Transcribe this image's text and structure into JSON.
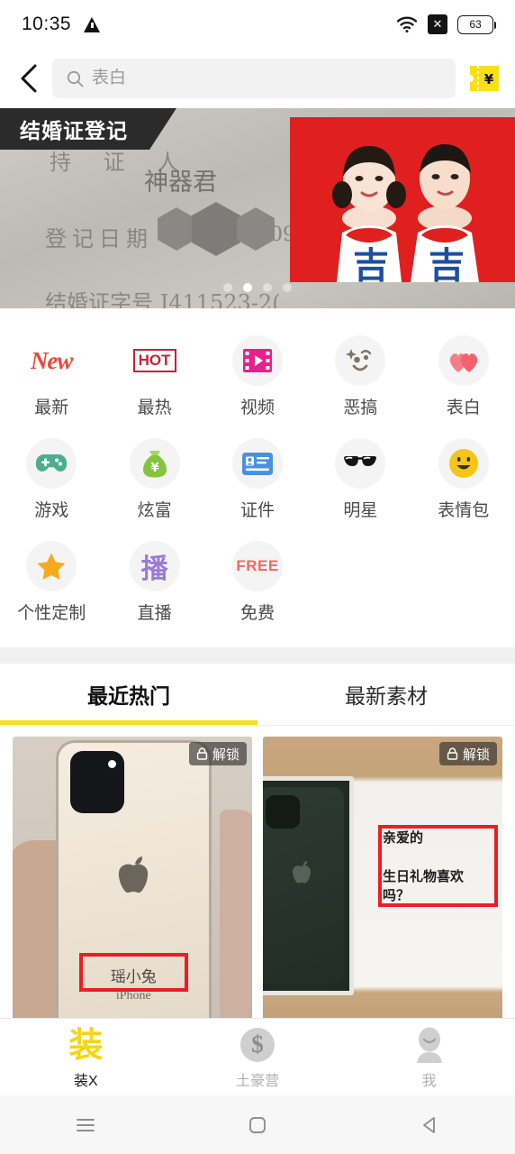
{
  "status_bar": {
    "time": "10:35",
    "warning_icon": "warning-triangle-icon",
    "wifi_icon": "wifi-icon",
    "signal_badge": "✕",
    "battery_level": "63"
  },
  "header": {
    "back_icon": "back-chevron-icon",
    "search": {
      "icon": "search-icon",
      "placeholder": "表白",
      "value": ""
    },
    "coupon": {
      "icon": "coupon-icon",
      "symbol": "¥",
      "color": "#f7e016"
    }
  },
  "banner": {
    "tag_label": "结婚证登记",
    "cert_text": {
      "line1": "持 证 人",
      "line2": "神器君",
      "line3": "登记日期",
      "line4": "结婚证字号 J411523-2(",
      "partial_date": "09"
    },
    "dots_total": 4,
    "dots_active_index": 1
  },
  "icon_grid": {
    "items": [
      {
        "label": "最新",
        "icon": "new-badge-icon",
        "glyph": "New",
        "style": "new",
        "color": "#f0453a"
      },
      {
        "label": "最热",
        "icon": "hot-badge-icon",
        "glyph": "HOT",
        "style": "hot",
        "color": "#c9213a"
      },
      {
        "label": "视频",
        "icon": "video-film-icon",
        "glyph": "",
        "style": "svg",
        "color": "#e6218c"
      },
      {
        "label": "恶搞",
        "icon": "prank-face-icon",
        "glyph": "",
        "style": "svg",
        "color": "#7d7468"
      },
      {
        "label": "表白",
        "icon": "double-heart-icon",
        "glyph": "",
        "style": "svg",
        "color": "#f4606c"
      },
      {
        "label": "游戏",
        "icon": "gamepad-icon",
        "glyph": "",
        "style": "svg",
        "color": "#4cae8f"
      },
      {
        "label": "炫富",
        "icon": "money-bag-icon",
        "glyph": "",
        "style": "svg",
        "color": "#86c440"
      },
      {
        "label": "证件",
        "icon": "id-card-icon",
        "glyph": "",
        "style": "svg",
        "color": "#4a90e2"
      },
      {
        "label": "明星",
        "icon": "sunglasses-icon",
        "glyph": "",
        "style": "svg",
        "color": "#1c1c1c"
      },
      {
        "label": "表情包",
        "icon": "smiley-emoji-icon",
        "glyph": "",
        "style": "svg",
        "color": "#f5c518"
      },
      {
        "label": "个性定制",
        "icon": "star-icon",
        "glyph": "",
        "style": "svg",
        "color": "#f6ab1d"
      },
      {
        "label": "直播",
        "icon": "live-broadcast-icon",
        "glyph": "播",
        "style": "bo",
        "color": "#9b7ad6"
      },
      {
        "label": "免费",
        "icon": "free-badge-icon",
        "glyph": "FREE",
        "style": "free",
        "color": "#f06a5e"
      }
    ]
  },
  "tabs": {
    "items": [
      {
        "label": "最近热门",
        "active": true
      },
      {
        "label": "最新素材",
        "active": false
      }
    ],
    "active_underline_color": "#f6dd1e"
  },
  "cards": [
    {
      "name": "gold-iphone-card",
      "badge_label": "解锁",
      "badge_icon": "lock-icon",
      "overlay_name": "瑶小兔",
      "overlay_sub": "iPhone"
    },
    {
      "name": "green-iphone-box-card",
      "badge_label": "解锁",
      "badge_icon": "lock-icon",
      "handwriting_line1": "亲爱的",
      "handwriting_line2": "生日礼物喜欢吗？"
    }
  ],
  "bottom_nav": {
    "items": [
      {
        "label": "装X",
        "icon": "zhuang-logo-icon",
        "glyph": "装",
        "active": true
      },
      {
        "label": "土豪营",
        "icon": "dollar-circle-icon",
        "glyph": "$",
        "active": false
      },
      {
        "label": "我",
        "icon": "profile-person-icon",
        "glyph": "",
        "active": false
      }
    ],
    "active_color": "#f5d516"
  },
  "android_nav": {
    "recents_icon": "recents-menu-icon",
    "home_icon": "home-square-icon",
    "back_icon": "back-triangle-icon"
  }
}
